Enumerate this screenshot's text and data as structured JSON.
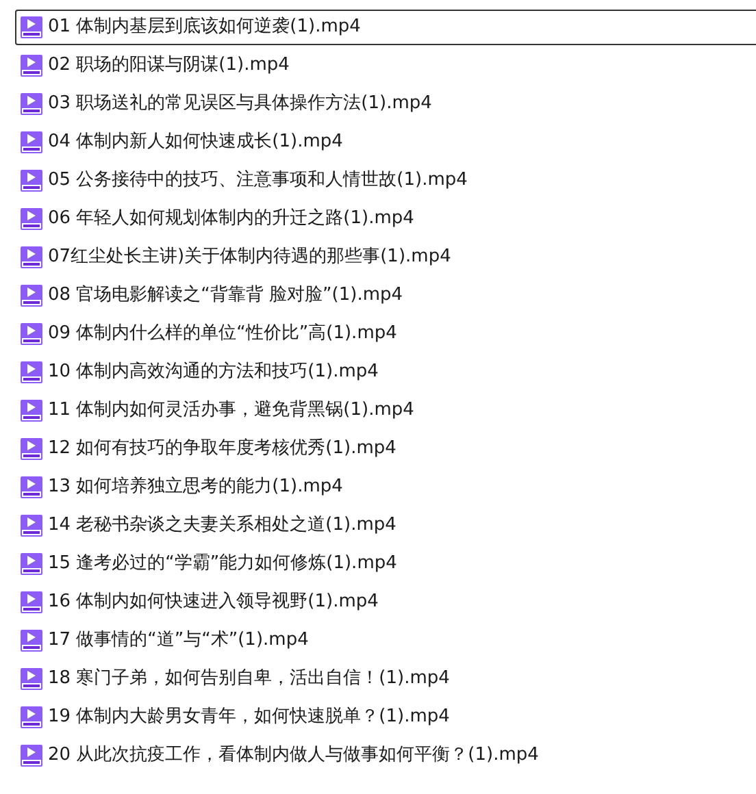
{
  "files": [
    {
      "name": "01 体制内基层到底该如何逆袭(1).mp4",
      "selected": true
    },
    {
      "name": "02 职场的阳谋与阴谋(1).mp4",
      "selected": false
    },
    {
      "name": "03 职场送礼的常见误区与具体操作方法(1).mp4",
      "selected": false
    },
    {
      "name": "04 体制内新人如何快速成长(1).mp4",
      "selected": false
    },
    {
      "name": "05 公务接待中的技巧、注意事项和人情世故(1).mp4",
      "selected": false
    },
    {
      "name": "06 年轻人如何规划体制内的升迁之路(1).mp4",
      "selected": false
    },
    {
      "name": "07红尘处长主讲)关于体制内待遇的那些事(1).mp4",
      "selected": false
    },
    {
      "name": "08 官场电影解读之“背靠背 脸对脸”(1).mp4",
      "selected": false
    },
    {
      "name": "09 体制内什么样的单位“性价比”高(1).mp4",
      "selected": false
    },
    {
      "name": "10 体制内高效沟通的方法和技巧(1).mp4",
      "selected": false
    },
    {
      "name": "11 体制内如何灵活办事，避免背黑锅(1).mp4",
      "selected": false
    },
    {
      "name": "12 如何有技巧的争取年度考核优秀(1).mp4",
      "selected": false
    },
    {
      "name": "13 如何培养独立思考的能力(1).mp4",
      "selected": false
    },
    {
      "name": "14 老秘书杂谈之夫妻关系相处之道(1).mp4",
      "selected": false
    },
    {
      "name": "15 逢考必过的“学霸”能力如何修炼(1).mp4",
      "selected": false
    },
    {
      "name": "16 体制内如何快速进入领导视野(1).mp4",
      "selected": false
    },
    {
      "name": "17 做事情的“道”与“术”(1).mp4",
      "selected": false
    },
    {
      "name": "18 寒门子弟，如何告别自卑，活出自信！(1).mp4",
      "selected": false
    },
    {
      "name": "19 体制内大龄男女青年，如何快速脱单？(1).mp4",
      "selected": false
    },
    {
      "name": "20 从此次抗疫工作，看体制内做人与做事如何平衡？(1).mp4",
      "selected": false
    }
  ]
}
